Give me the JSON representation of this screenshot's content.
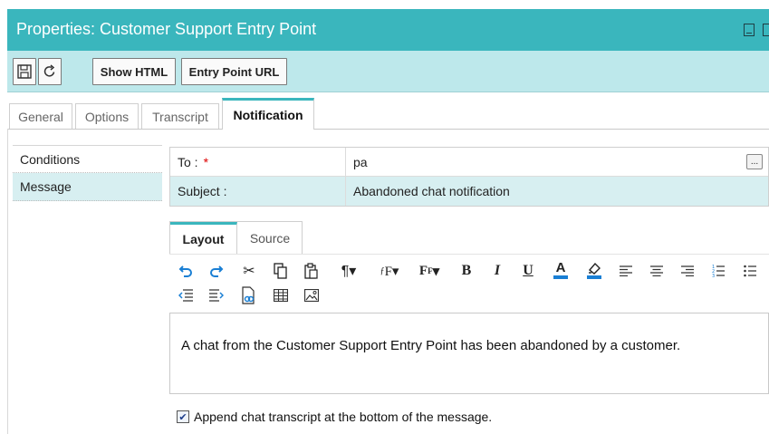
{
  "window": {
    "title": "Properties: Customer Support Entry Point"
  },
  "toolbar": {
    "save_icon": "floppy-disk-icon",
    "refresh_icon": "refresh-icon",
    "show_html": "Show HTML",
    "entry_point_url": "Entry Point URL"
  },
  "tabs": [
    {
      "label": "General",
      "active": false
    },
    {
      "label": "Options",
      "active": false
    },
    {
      "label": "Transcript",
      "active": false
    },
    {
      "label": "Notification",
      "active": true
    }
  ],
  "nav": {
    "items": [
      {
        "label": "Conditions",
        "selected": false
      },
      {
        "label": "Message",
        "selected": true
      }
    ]
  },
  "fields": {
    "to_label": "To :",
    "to_required": "*",
    "to_value": "pa",
    "browse_label": "...",
    "subject_label": "Subject :",
    "subject_value": "Abandoned chat notification"
  },
  "editor_tabs": {
    "layout": "Layout",
    "source": "Source"
  },
  "editor": {
    "body": "A chat from the Customer Support Entry Point has been abandoned by a customer."
  },
  "append_option": {
    "checked": true,
    "label": "Append chat transcript at the bottom of the message."
  },
  "format_icons": [
    "undo-icon",
    "redo-icon",
    "cut-icon",
    "copy-icon",
    "paste-icon",
    "paragraph-format-icon",
    "font-family-icon",
    "font-size-icon",
    "bold-icon",
    "italic-icon",
    "underline-icon",
    "font-color-icon",
    "highlight-color-icon",
    "align-left-icon",
    "align-center-icon",
    "align-right-icon",
    "ordered-list-icon",
    "unordered-list-icon",
    "outdent-icon",
    "indent-icon",
    "insert-link-icon",
    "insert-table-icon",
    "insert-image-icon"
  ],
  "colors": {
    "accent": "#3ab6bd",
    "toolbar_bg": "#bde8eb",
    "selected_row": "#d7eff1",
    "required": "#dd0000",
    "icon_blue": "#1a7fd4"
  }
}
